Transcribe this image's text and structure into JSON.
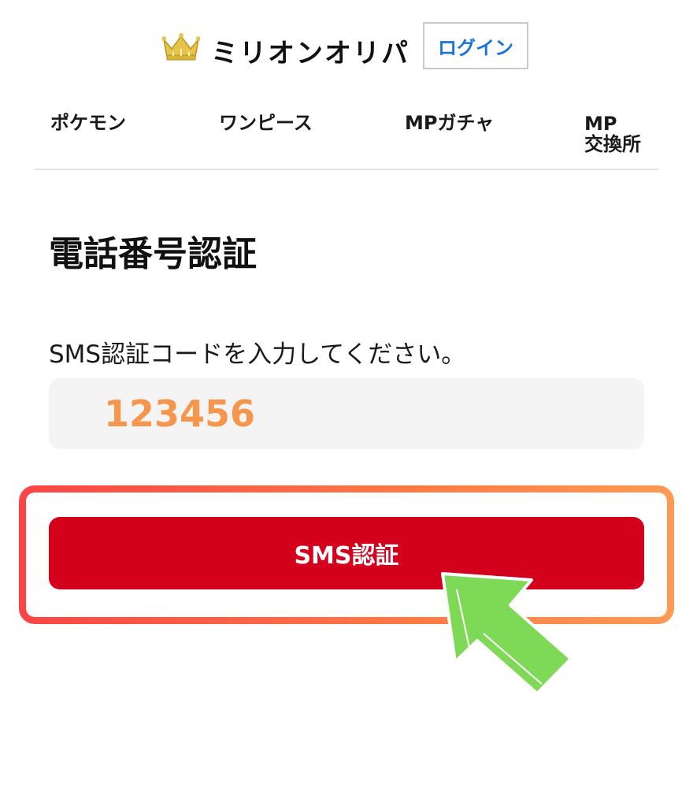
{
  "header": {
    "brand_name": "ミリオンオリパ",
    "login_label": "ログイン",
    "crown_icon": "crown-icon",
    "crown_color": "#e8c54a"
  },
  "nav": {
    "items": [
      {
        "label": "ポケモン"
      },
      {
        "label": "ワンピース"
      },
      {
        "label": "MPガチャ"
      },
      {
        "label_line1": "MP",
        "label_line2": "交換所"
      }
    ]
  },
  "main": {
    "title": "電話番号認証",
    "instruction": "SMS認証コードを入力してください。",
    "code_value": "123456",
    "submit_label": "SMS認証"
  },
  "colors": {
    "accent_red": "#d4011d",
    "code_orange": "#f5964c",
    "login_blue": "#1a73d9",
    "highlight_gradient_start": "#f94545",
    "highlight_gradient_end": "#ff9a55",
    "pointer_green": "#7ed957"
  },
  "annotation": {
    "pointer_icon": "arrow-pointer-icon"
  }
}
